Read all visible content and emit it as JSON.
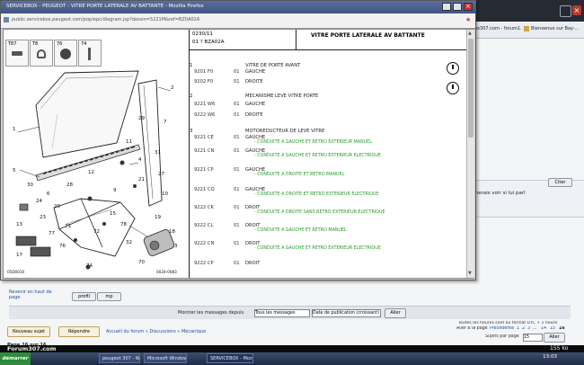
{
  "background_page": {
    "tab_label_1": "ques307.com - forum1...",
    "tab_label_2": "Bienvenue sur Bay-...",
    "quote_button": "Citer",
    "snippet_text": "aimerais voir si lui parl",
    "back_to_top": "Revenir en haut de page",
    "profile_button": "profil",
    "mp_button": "mp",
    "filter_label": "Montrer les messages depuis",
    "filter_select_1": "Tous les messages",
    "filter_select_2": "Date de publication (croissant)",
    "go_button": "Aller",
    "new_topic_button": "Nouveau sujet",
    "reply_button": "Répondre",
    "breadcrumb": "Accueil du forum » Discussions » Mécanique",
    "page_indicator": "Page 16 sur 16",
    "timezone_note": "Toutes les heures sont au format UTC + 1 heure",
    "goto_page_label": "Aller à la page",
    "goto_prev": "Précédente",
    "goto_pages": [
      "1",
      "2",
      "3",
      "...",
      "14",
      "15",
      "16"
    ],
    "per_page_label": "Sujets par page",
    "per_page_value": "15",
    "per_page_button": "Aller",
    "footer_logo": "Forum307.com",
    "page_size": "155 ko"
  },
  "popup": {
    "title": "SERVICEBOX - PEUGEOT - VITRE PORTE LATERALE AV BATTANTE - Mozilla Firefox",
    "address": "public.servicebox.peugeot.com/pop/epc/diagram.jsp?dessin=5221M&ref=BZ0A02A",
    "header_code_1": "0230/11",
    "header_code_2": "01 ? BZA02A",
    "header_title": "VITRE PORTE LATERALE AV BATTANTE",
    "diagram_numbers": [
      "1",
      "2",
      "3",
      "4",
      "5",
      "6",
      "7",
      "9",
      "10",
      "11",
      "12",
      "13",
      "15",
      "17",
      "18",
      "19",
      "20",
      "21",
      "23",
      "24",
      "27",
      "28",
      "29",
      "30",
      "31",
      "32",
      "70",
      "71",
      "72",
      "74",
      "76",
      "77",
      "78"
    ],
    "diagram_footer_left": "05D0010",
    "diagram_footer_right": "0024-0083",
    "thumbs": [
      {
        "label": "T87",
        "icon": "bolt-icon"
      },
      {
        "label": "T8",
        "icon": "clip-icon"
      },
      {
        "label": "76",
        "icon": "grommet-icon"
      },
      {
        "label": "74",
        "icon": "screw-icon"
      }
    ],
    "parts": [
      {
        "num": "1",
        "ref": "",
        "qty": "",
        "desc": "VITRE DE PORTE AVANT",
        "notes": []
      },
      {
        "num": "",
        "ref": "9201 F0",
        "qty": "01",
        "desc": "GAUCHE",
        "notes": []
      },
      {
        "num": "",
        "ref": "9202 F0",
        "qty": "01",
        "desc": "DROITE",
        "notes": []
      },
      {
        "num": "2",
        "ref": "",
        "qty": "",
        "desc": "MECANISME LEVE VITRE PORTE",
        "notes": []
      },
      {
        "num": "",
        "ref": "9221 W6",
        "qty": "01",
        "desc": "GAUCHE",
        "notes": []
      },
      {
        "num": "",
        "ref": "9222 W6",
        "qty": "01",
        "desc": "DROITE",
        "notes": []
      },
      {
        "num": "3",
        "ref": "",
        "qty": "",
        "desc": "MOTOREDUCTEUR DE LEVE VITRE",
        "notes": []
      },
      {
        "num": "",
        "ref": "9221 CE",
        "qty": "01",
        "desc": "GAUCHE",
        "notes": [
          "- CONDUITE A GAUCHE ET RETRO EXTERIEUR MANUEL"
        ]
      },
      {
        "num": "",
        "ref": "9221 CN",
        "qty": "01",
        "desc": "GAUCHE",
        "notes": [
          "- CONDUITE A GAUCHE ET RETRO EXTERIEUR ELECTRIQUE"
        ]
      },
      {
        "num": "",
        "ref": "9221 CP",
        "qty": "01",
        "desc": "GAUCHE",
        "notes": [
          "- CONDUITE A DROITE ET RETRO MANUEL"
        ]
      },
      {
        "num": "",
        "ref": "9221 CQ",
        "qty": "01",
        "desc": "GAUCHE",
        "notes": [
          "- CONDUITE A DROITE ET RETRO EXTERIEUR ELECTRIQUE"
        ]
      },
      {
        "num": "",
        "ref": "9222 CK",
        "qty": "01",
        "desc": "DROIT",
        "notes": [
          "- CONDUITE A DROITE SANS RETRO EXTERIEUR ELECTRIQUE"
        ]
      },
      {
        "num": "",
        "ref": "9222 CL",
        "qty": "01",
        "desc": "DROIT",
        "notes": [
          "- CONDUITE A GAUCHE ET RETRO MANUEL"
        ]
      },
      {
        "num": "",
        "ref": "9222 CN",
        "qty": "01",
        "desc": "DROIT",
        "notes": [
          "- CONDUITE A GAUCHE ET RETRO EXTERIEUR ELECTRIQUE"
        ]
      },
      {
        "num": "",
        "ref": "9222 CP",
        "qty": "01",
        "desc": "DROIT",
        "notes": []
      }
    ]
  },
  "taskbar": {
    "start_label": "démarrer",
    "items": [
      "peugeot 307 - Windows...",
      "Microsoft Windows",
      "SERVICEBOX - Mozilla..."
    ],
    "clock": "13:03"
  }
}
